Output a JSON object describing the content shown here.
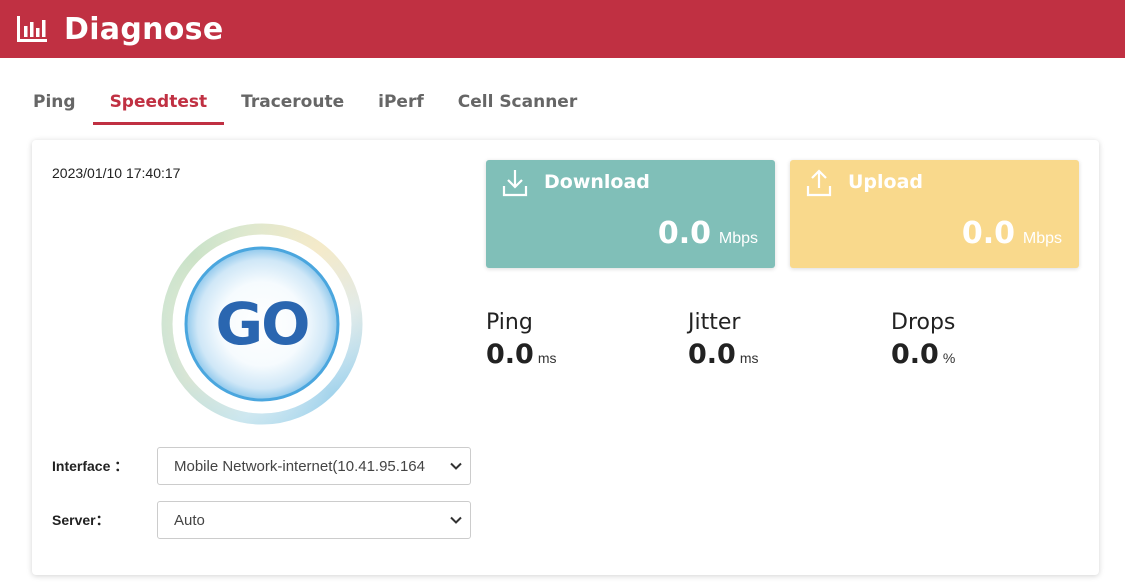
{
  "header": {
    "title": "Diagnose",
    "logo_icon": "bar-chart-icon",
    "color": "#c03042"
  },
  "tabs": [
    {
      "label": "Ping",
      "active": false
    },
    {
      "label": "Speedtest",
      "active": true
    },
    {
      "label": "Traceroute",
      "active": false
    },
    {
      "label": "iPerf",
      "active": false
    },
    {
      "label": "Cell Scanner",
      "active": false
    }
  ],
  "speedtest": {
    "timestamp": "2023/01/10 17:40:17",
    "go_label": "GO",
    "interface": {
      "label": "Interface ：",
      "value": "Mobile Network-internet(10.41.95.164"
    },
    "server": {
      "label": "Server：",
      "value": "Auto"
    },
    "download": {
      "label": "Download",
      "value": "0.0",
      "unit": "Mbps",
      "icon": "download-icon",
      "color": "#80bfb8"
    },
    "upload": {
      "label": "Upload",
      "value": "0.0",
      "unit": "Mbps",
      "icon": "upload-icon",
      "color": "#f9d98c"
    },
    "metrics": [
      {
        "label": "Ping",
        "value": "0.0",
        "unit": "ms"
      },
      {
        "label": "Jitter",
        "value": "0.0",
        "unit": "ms"
      },
      {
        "label": "Drops",
        "value": "0.0",
        "unit": "%"
      }
    ]
  }
}
